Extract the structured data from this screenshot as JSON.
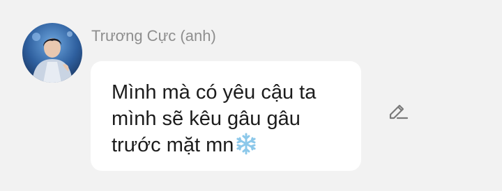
{
  "sender": {
    "name": "Trương Cực (anh)",
    "avatar_icon": "profile-photo"
  },
  "message": {
    "lines": [
      "Mình mà có yêu cậu ta",
      "mình sẽ kêu gâu gâu",
      "trước mặt mn"
    ],
    "emoji": "snowflake-icon"
  },
  "actions": {
    "edit_icon": "pencil-icon"
  },
  "colors": {
    "background": "#f2f2f2",
    "bubble": "#ffffff",
    "sender_name": "#8e8e8e",
    "message_text": "#1c1c1c",
    "snowflake": "#8cc8ea"
  }
}
